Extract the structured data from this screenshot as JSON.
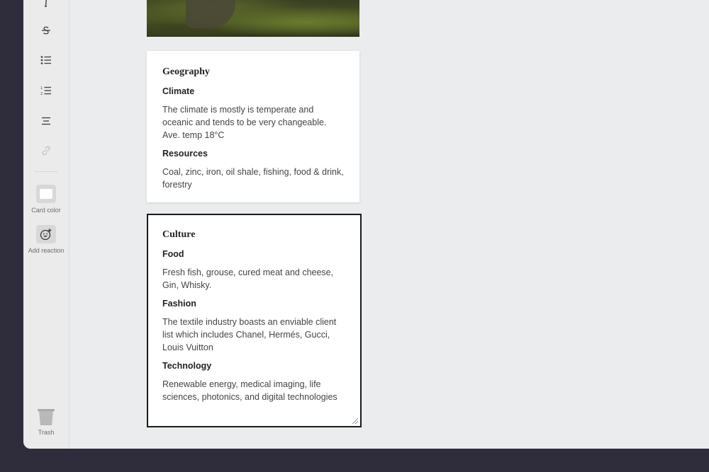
{
  "toolbar": {
    "card_color_label": "Card color",
    "add_reaction_label": "Add reaction",
    "trash_label": "Trash"
  },
  "cards": {
    "geography": {
      "title": "Geography",
      "sections": [
        {
          "heading": "Climate",
          "text": "The climate is mostly is temperate and oceanic and tends to be very changeable. Ave. temp 18°C"
        },
        {
          "heading": "Resources",
          "text": "Coal, zinc, iron, oil shale, fishing, food & drink, forestry"
        }
      ]
    },
    "culture": {
      "title": "Culture",
      "sections": [
        {
          "heading": "Food",
          "text": "Fresh fish, grouse, cured meat and cheese, Gin, Whisky."
        },
        {
          "heading": "Fashion",
          "text": "The textile industry boasts an enviable client list which includes Chanel, Hermés, Gucci, Louis Vuitton"
        },
        {
          "heading": "Technology",
          "text": "Renewable energy, medical imaging, life sciences, photonics, and digital technologies"
        }
      ]
    }
  },
  "colors": {
    "background": "#2f2d3b",
    "canvas": "#ebeced",
    "card": "#ffffff",
    "selected_border": "#1a1a1a"
  }
}
